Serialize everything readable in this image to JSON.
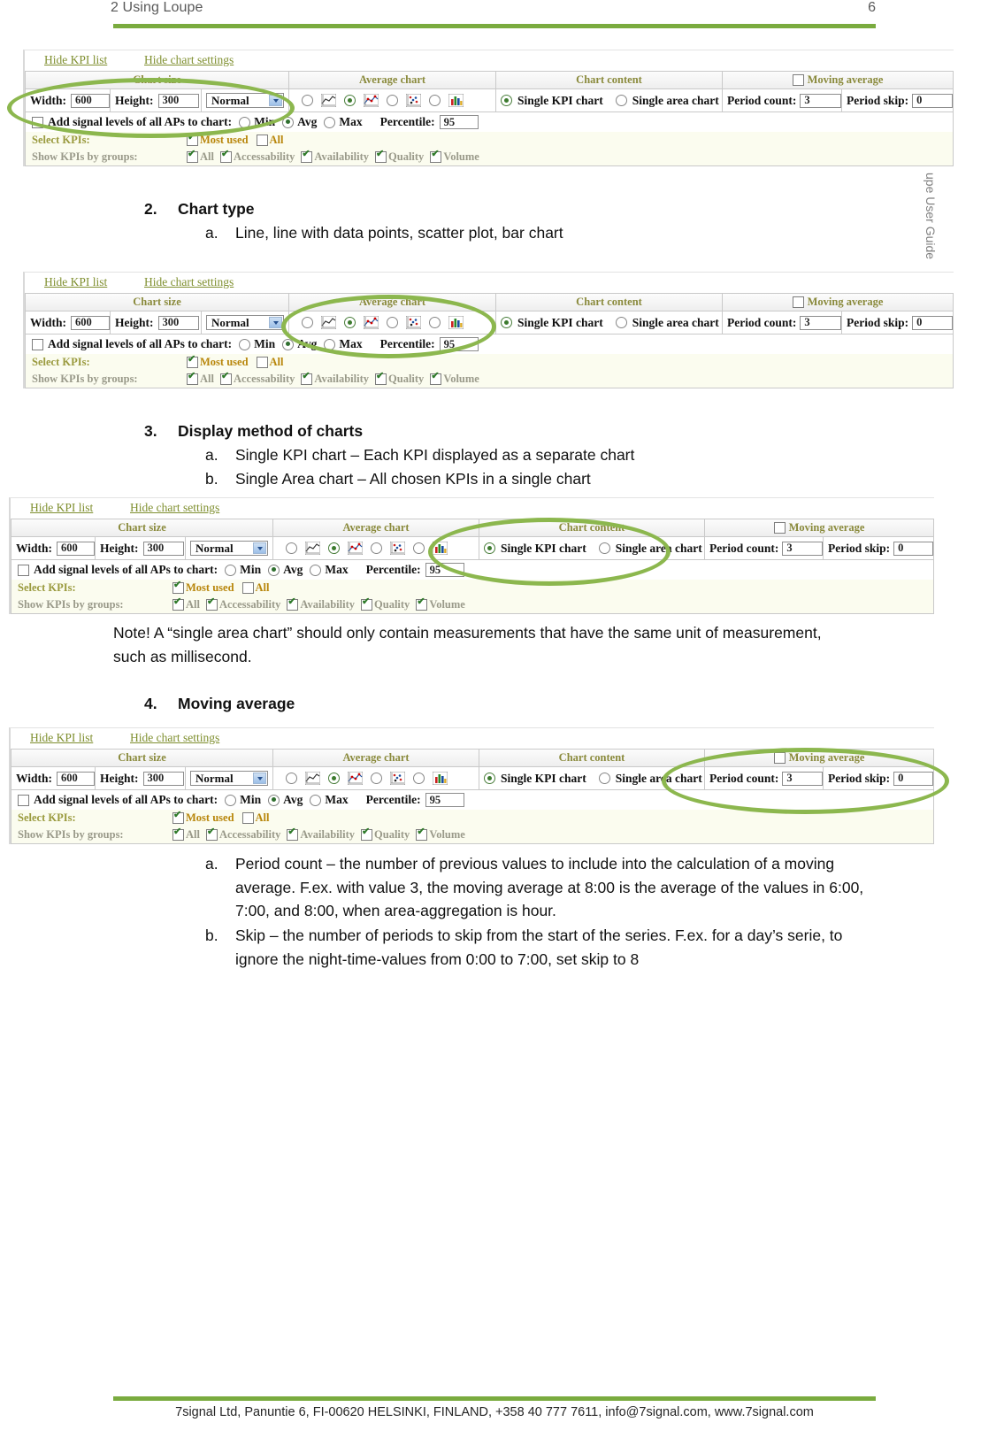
{
  "header": {
    "title": "2 Using Loupe",
    "page_number": "6"
  },
  "side_caption": "upe User Guide",
  "footer": "7signal Ltd, Panuntie 6, FI-00620 HELSINKI, FINLAND, +358 40 777 7611, info@7signal.com, www.7signal.com",
  "accent_color": "#7aab3f",
  "annotation_color": "#8cb74e",
  "body": {
    "item2": {
      "num": "2.",
      "text": "Chart type"
    },
    "item2a": {
      "letter": "a.",
      "text": "Line, line with data points, scatter plot, bar chart"
    },
    "item3": {
      "num": "3.",
      "text": "Display method of charts"
    },
    "item3a": {
      "letter": "a.",
      "text": "Single KPI chart – Each KPI displayed as a separate chart"
    },
    "item3b": {
      "letter": "b.",
      "text": "Single Area chart – All chosen KPIs in a single chart"
    },
    "note": "Note! A “single area chart” should only contain measurements that have the same unit of measurement, such as millisecond.",
    "item4": {
      "num": "4.",
      "text": "Moving average"
    },
    "item4a": {
      "letter": "a.",
      "text": "Period count – the number of previous values to include into the calculation of a moving average. F.ex. with value 3, the moving average at 8:00 is the average of the values in 6:00, 7:00, and 8:00, when area-aggregation is hour."
    },
    "item4b": {
      "letter": "b.",
      "text": "Skip – the number of periods to skip from the start of the series. F.ex. for a day’s serie, to ignore the night-time-values from 0:00 to 7:00, set skip to 8"
    }
  },
  "app": {
    "links": {
      "hide_kpi_list": "Hide KPI list",
      "hide_chart_settings": "Hide chart settings"
    },
    "headers": {
      "chart_size": "Chart size",
      "average_chart": "Average chart",
      "chart_content": "Chart content",
      "moving_average": "Moving average"
    },
    "fields": {
      "width_label": "Width:",
      "width_value": "600",
      "height_label": "Height:",
      "height_value": "300",
      "size_preset": "Normal",
      "period_count_label": "Period count:",
      "period_count_value": "3",
      "period_skip_label": "Period skip:",
      "period_skip_value": "0",
      "percentile_label": "Percentile:",
      "percentile_value": "95",
      "add_signal_levels": "Add signal levels of all APs to chart:",
      "min": "Min",
      "avg": "Avg",
      "max": "Max"
    },
    "chart_content": {
      "single_kpi_chart": "Single KPI chart",
      "single_area_chart": "Single area chart"
    },
    "chart_types": [
      {
        "name": "line-chart-icon",
        "selected": false
      },
      {
        "name": "line-with-points-chart-icon",
        "selected": true
      },
      {
        "name": "scatter-plot-chart-icon",
        "selected": false
      },
      {
        "name": "bar-chart-icon",
        "selected": false
      }
    ],
    "kpi": {
      "select_kpis_label": "Select KPIs:",
      "most_used": "Most used",
      "all": "All",
      "show_by_groups_label": "Show KPIs by groups:",
      "groups": [
        "All",
        "Accessability",
        "Availability",
        "Quality",
        "Volume"
      ]
    }
  }
}
